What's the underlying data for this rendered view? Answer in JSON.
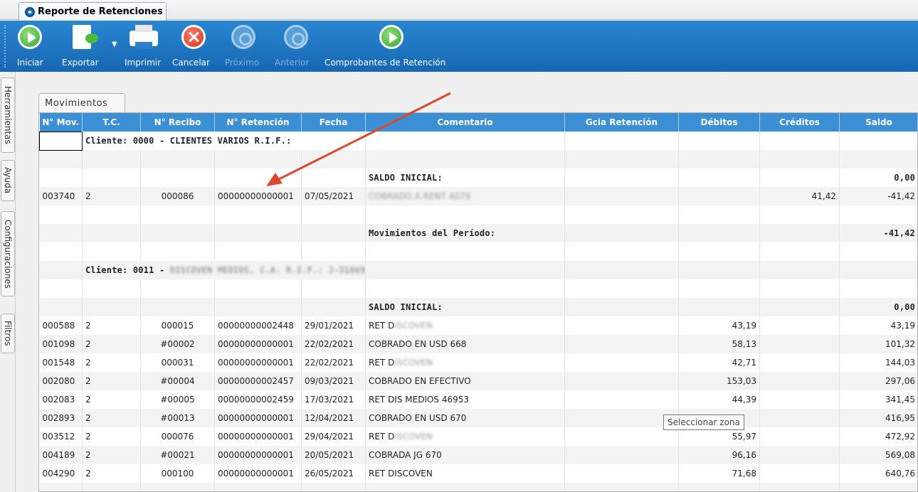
{
  "document_tab": {
    "title": "Reporte de Retenciones"
  },
  "toolbar": {
    "iniciar": "Iniciar",
    "exportar": "Exportar",
    "imprimir": "Imprimir",
    "cancelar": "Cancelar",
    "proximo": "Próximo",
    "anterior": "Anterior",
    "comprobantes": "Comprobantes de Retención"
  },
  "sidebar": {
    "herramientas": "Herramientas",
    "ayuda": "Ayuda",
    "configuraciones": "Configuraciones",
    "filtros": "Filtros"
  },
  "tab": {
    "movimientos": "Movimientos"
  },
  "columns": [
    "N° Mov.",
    "T.C.",
    "N° Recibo",
    "N° Retención",
    "Fecha",
    "Comentario",
    "Gcia Retención",
    "Débitos",
    "Créditos",
    "Saldo"
  ],
  "rows": [
    {
      "mov": "",
      "cliente": "Cliente: 0000 - CLIENTES VARIOS R.I.F.:"
    },
    {
      "blank": true
    },
    {
      "comentario": "SALDO INICIAL:",
      "saldo": "0,00",
      "bold": true
    },
    {
      "mov": "003740",
      "tc": "2",
      "recibo": "000086",
      "retencion": "00000000000001",
      "fecha": "07/05/2021",
      "comentario": "COBRADO A RENT 4079",
      "blurComment": true,
      "creditos": "41,42",
      "saldo": "-41,42"
    },
    {
      "blank": true
    },
    {
      "comentario": "Movimientos del Período:",
      "saldo": "-41,42",
      "bold": true
    },
    {
      "blank": true
    },
    {
      "cliente": "Cliente: 0011 - ",
      "clienteBlur": "DISCOVEN MEDIOS, C.A. R.I.F.: J-31869669"
    },
    {
      "blank": true
    },
    {
      "comentario": "SALDO INICIAL:",
      "saldo": "0,00",
      "bold": true
    },
    {
      "mov": "000588",
      "tc": "2",
      "recibo": "000015",
      "retencion": "00000000002448",
      "fecha": "29/01/2021",
      "comentario": "RET D",
      "commentBlur": "ISCOVEN",
      "debitos": "43,19",
      "saldo": "43,19"
    },
    {
      "mov": "001098",
      "tc": "2",
      "recibo": "#00002",
      "retencion": "00000000000001",
      "fecha": "22/02/2021",
      "comentario": "COBRADO EN USD 668",
      "debitos": "58,13",
      "saldo": "101,32"
    },
    {
      "mov": "001548",
      "tc": "2",
      "recibo": "000031",
      "retencion": "00000000000001",
      "fecha": "22/02/2021",
      "comentario": "RET D",
      "commentBlur": "ISCOVEN",
      "debitos": "42,71",
      "saldo": "144,03"
    },
    {
      "mov": "002080",
      "tc": "2",
      "recibo": "#00004",
      "retencion": "00000000002457",
      "fecha": "09/03/2021",
      "comentario": "COBRADO EN EFECTIVO",
      "debitos": "153,03",
      "saldo": "297,06"
    },
    {
      "mov": "002083",
      "tc": "2",
      "recibo": "#00005",
      "retencion": "00000000002459",
      "fecha": "17/03/2021",
      "comentario": "RET DIS MEDIOS 46953",
      "debitos": "44,39",
      "saldo": "341,45"
    },
    {
      "mov": "002893",
      "tc": "2",
      "recibo": "#00013",
      "retencion": "00000000000001",
      "fecha": "12/04/2021",
      "comentario": "COBRADO EN USD 670",
      "debitos": "",
      "saldo": "416,95"
    },
    {
      "mov": "003512",
      "tc": "2",
      "recibo": "000076",
      "retencion": "00000000000001",
      "fecha": "29/04/2021",
      "comentario": "RET D",
      "commentBlur": "ISCOVEN",
      "debitos": "55,97",
      "saldo": "472,92"
    },
    {
      "mov": "004189",
      "tc": "2",
      "recibo": "#00021",
      "retencion": "00000000000001",
      "fecha": "20/05/2021",
      "comentario": "COBRADA JG 670",
      "debitos": "96,16",
      "saldo": "569,08"
    },
    {
      "mov": "004290",
      "tc": "2",
      "recibo": "000100",
      "retencion": "00000000000001",
      "fecha": "26/05/2021",
      "comentario": "RET DISCOVEN",
      "debitos": "71,68",
      "saldo": "640,76"
    }
  ],
  "tooltip": "Seleccionar zona",
  "colors": {
    "toolbar": "#1a6fbd",
    "header": "#3b8fd4",
    "arrow": "#e0452f"
  }
}
